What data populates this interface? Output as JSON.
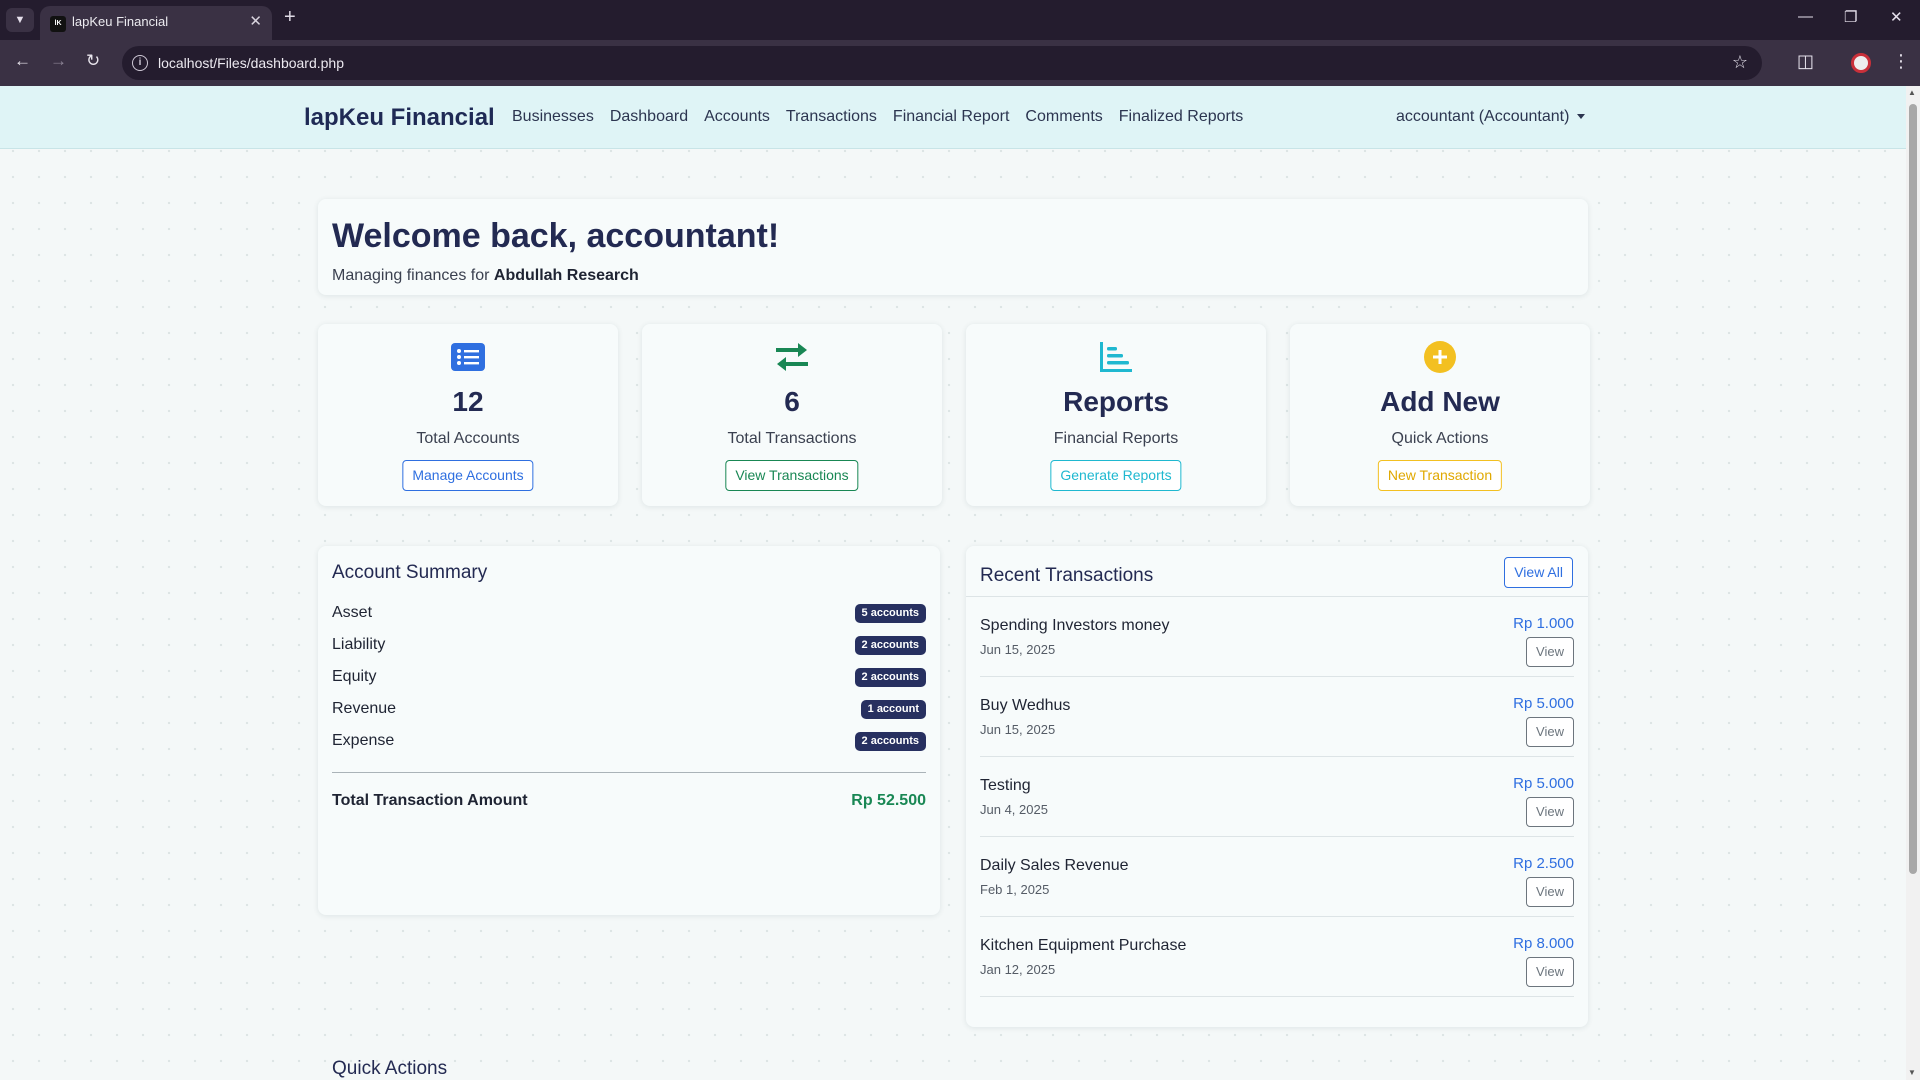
{
  "browser": {
    "tab_title": "lapKeu Financial",
    "favicon_text": "lK",
    "url": "localhost/Files/dashboard.php"
  },
  "nav": {
    "brand": "lapKeu Financial",
    "links": [
      "Businesses",
      "Dashboard",
      "Accounts",
      "Transactions",
      "Financial Report",
      "Comments",
      "Finalized Reports"
    ],
    "user": "accountant (Accountant)"
  },
  "welcome": {
    "title": "Welcome back, accountant!",
    "subtitle_prefix": "Managing finances for",
    "business": "Abdullah Research"
  },
  "stats": [
    {
      "icon": "list-icon",
      "value": "12",
      "label": "Total Accounts",
      "button": "Manage Accounts",
      "color": "#2f6fe0"
    },
    {
      "icon": "exchange-arrows-icon",
      "value": "6",
      "label": "Total Transactions",
      "button": "View Transactions",
      "color": "#198754"
    },
    {
      "icon": "bar-chart-icon",
      "value": "Reports",
      "label": "Financial Reports",
      "button": "Generate Reports",
      "color": "#1fb8d0"
    },
    {
      "icon": "plus-circle-icon",
      "value": "Add New",
      "label": "Quick Actions",
      "button": "New Transaction",
      "color": "#f3c021"
    }
  ],
  "summary": {
    "title": "Account Summary",
    "rows": [
      {
        "name": "Asset",
        "count": "5 accounts"
      },
      {
        "name": "Liability",
        "count": "2 accounts"
      },
      {
        "name": "Equity",
        "count": "2 accounts"
      },
      {
        "name": "Revenue",
        "count": "1 account"
      },
      {
        "name": "Expense",
        "count": "2 accounts"
      }
    ],
    "total_label": "Total Transaction Amount",
    "total_value": "Rp 52.500"
  },
  "recent": {
    "title": "Recent Transactions",
    "view_all": "View All",
    "view_label": "View",
    "items": [
      {
        "name": "Spending Investors money",
        "date": "Jun 15, 2025",
        "amount": "Rp 1.000"
      },
      {
        "name": "Buy Wedhus",
        "date": "Jun 15, 2025",
        "amount": "Rp 5.000"
      },
      {
        "name": "Testing",
        "date": "Jun 4, 2025",
        "amount": "Rp 5.000"
      },
      {
        "name": "Daily Sales Revenue",
        "date": "Feb 1, 2025",
        "amount": "Rp 2.500"
      },
      {
        "name": "Kitchen Equipment Purchase",
        "date": "Jan 12, 2025",
        "amount": "Rp 8.000"
      }
    ]
  },
  "quick_actions_title": "Quick Actions"
}
